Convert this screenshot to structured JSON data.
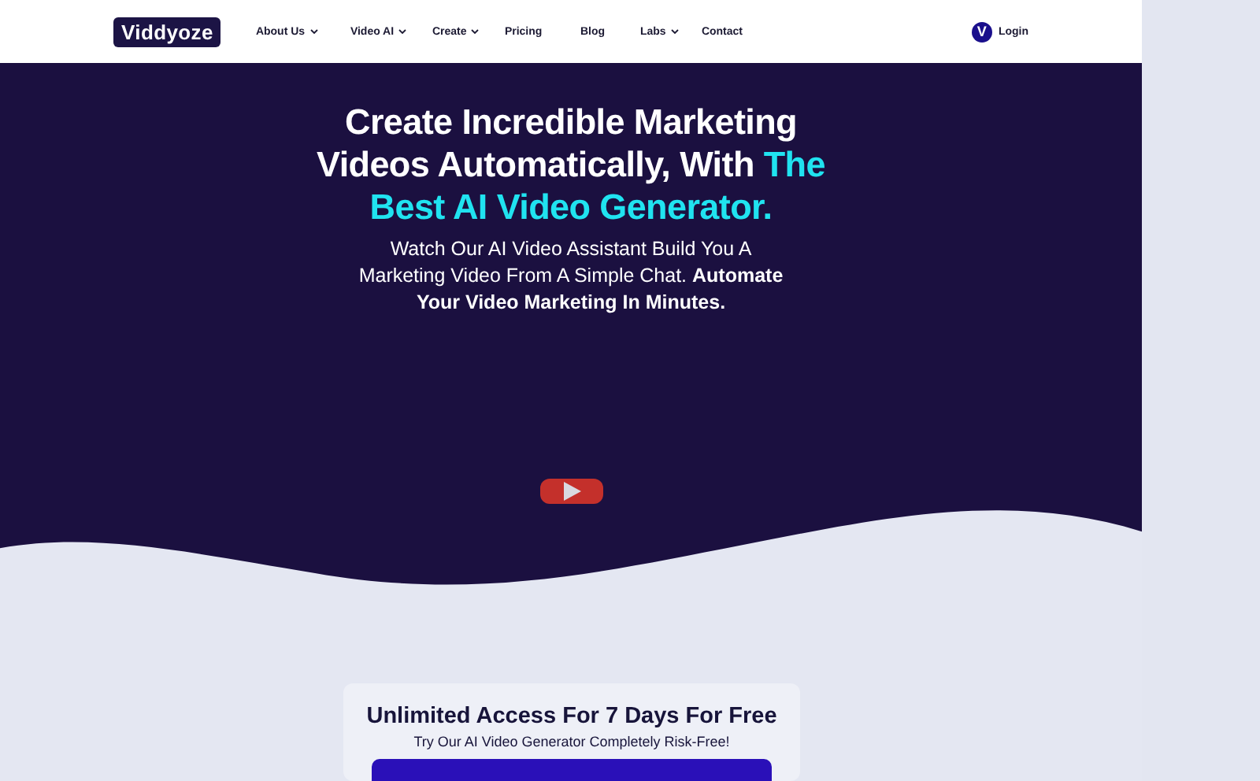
{
  "logo": {
    "text": "Viddyoze"
  },
  "nav": [
    {
      "label": "About Us",
      "has_menu": true
    },
    {
      "label": "Video AI",
      "has_menu": true
    },
    {
      "label": "Create",
      "has_menu": true
    },
    {
      "label": "Pricing",
      "has_menu": false
    },
    {
      "label": "Blog",
      "has_menu": false
    },
    {
      "label": "Labs",
      "has_menu": true
    },
    {
      "label": "Contact",
      "has_menu": false
    }
  ],
  "login": {
    "avatar": "V",
    "label": "Login"
  },
  "hero": {
    "title": "Create Incredible Marketing Videos Automatically, With",
    "title_highlight": "The Best AI Video Generator.",
    "subtitle": "Watch Our AI Video Assistant Build You A Marketing Video From A Simple Chat. **Automate Your Video Marketing In Minutes.**"
  },
  "offer": {
    "title": "Unlimited Access For 7 Days For Free",
    "subtitle": "Try Our AI Video Generator Completely Risk-Free!"
  }
}
